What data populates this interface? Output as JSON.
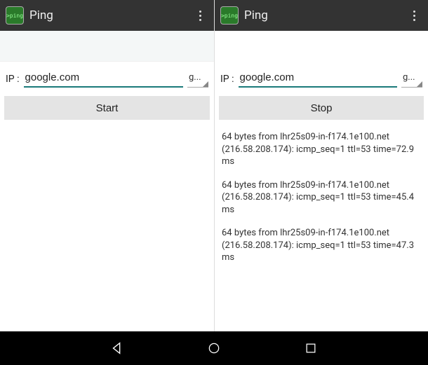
{
  "left": {
    "app_icon_text": ">ping",
    "app_title": "Ping",
    "ip_label": "IP :",
    "ip_value": "google.com",
    "spinner_value": "g...",
    "action_label": "Start"
  },
  "right": {
    "app_icon_text": ">ping",
    "app_title": "Ping",
    "ip_label": "IP :",
    "ip_value": "google.com",
    "spinner_value": "g...",
    "action_label": "Stop",
    "results": [
      "64 bytes from lhr25s09-in-f174.1e100.net (216.58.208.174): icmp_seq=1 ttl=53 time=72.9 ms",
      "64 bytes from lhr25s09-in-f174.1e100.net (216.58.208.174): icmp_seq=1 ttl=53 time=45.4 ms",
      "64 bytes from lhr25s09-in-f174.1e100.net (216.58.208.174): icmp_seq=1 ttl=53 time=47.3 ms"
    ]
  }
}
